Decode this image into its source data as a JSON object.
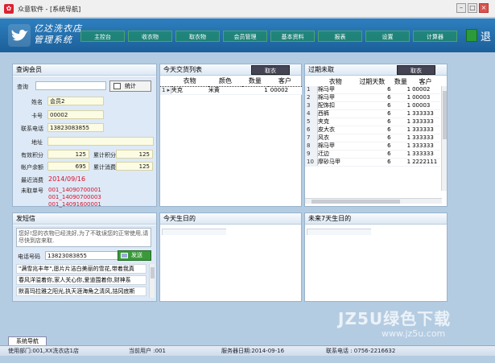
{
  "window": {
    "title": "众意软件 - [系统导航]",
    "app_icon": "app-logo-icon"
  },
  "brand": {
    "line1": "亿达洗衣店",
    "line2": "管理系统"
  },
  "nav": {
    "items": [
      "主控台",
      "收衣物",
      "取衣物",
      "会员管理",
      "基本资料",
      "报表",
      "设置",
      "计算器"
    ],
    "exit": "退"
  },
  "member": {
    "header": "查询会员",
    "query_label": "查询",
    "query_value": "",
    "stat_button": "统计",
    "name_label": "姓名",
    "name": "会员2",
    "card_label": "卡号",
    "card": "00002",
    "phone_label": "联系电话",
    "phone": "13823083855",
    "address_label": "地址",
    "address": "",
    "points_label": "有效积分",
    "points": "125",
    "total_points_label": "累计积分",
    "total_points": "125",
    "balance_label": "帐户余额",
    "balance": "695",
    "total_spent_label": "累计消费",
    "total_spent": "125",
    "last_spend_label": "最近消费",
    "last_spend": "2014/09/16",
    "unclaimed_label": "未取单号",
    "unclaimed": [
      "001_14090700001",
      "001_14090700003",
      "001_14091600001"
    ]
  },
  "today": {
    "header": "今天交货列表",
    "button": "取衣",
    "columns": [
      "衣物",
      "颜色",
      "数量",
      "客户"
    ],
    "rows": [
      {
        "idx": "1 ▸",
        "item": "夹克",
        "color": "米黄",
        "qty": "1",
        "customer": "00002"
      }
    ]
  },
  "overdue": {
    "header": "过期未取",
    "button": "取衣",
    "columns": [
      "衣物",
      "过期天数",
      "数量",
      "客户"
    ],
    "rows": [
      {
        "idx": "1",
        "item": "棉马甲",
        "days": "6",
        "qty": "1",
        "customer": "00002"
      },
      {
        "idx": "2",
        "item": "棉马甲",
        "days": "6",
        "qty": "1",
        "customer": "00003"
      },
      {
        "idx": "3",
        "item": "配饰扣",
        "days": "6",
        "qty": "1",
        "customer": "00003"
      },
      {
        "idx": "4",
        "item": "西裤",
        "days": "6",
        "qty": "1",
        "customer": "333333"
      },
      {
        "idx": "5",
        "item": "夹克",
        "days": "6",
        "qty": "1",
        "customer": "333333"
      },
      {
        "idx": "6",
        "item": "皮大衣",
        "days": "6",
        "qty": "1",
        "customer": "333333"
      },
      {
        "idx": "7",
        "item": "风衣",
        "days": "6",
        "qty": "1",
        "customer": "333333"
      },
      {
        "idx": "8",
        "item": "棉马甲",
        "days": "6",
        "qty": "1",
        "customer": "333333"
      },
      {
        "idx": "9",
        "item": "迁边",
        "days": "6",
        "qty": "1",
        "customer": "333333"
      },
      {
        "idx": "10",
        "item": "摩砂马甲",
        "days": "6",
        "qty": "1",
        "customer": "2222111"
      }
    ]
  },
  "sms": {
    "header": "发短信",
    "message": "您好!您的衣物已经洗好,为了不耽误您的正常使用,请尽快到店来取.",
    "phone_label": "电话号码",
    "phone": "13823083855",
    "send": "发送",
    "templates": [
      "\"满雪兆丰年\",愿片片洁白美丽的雪花,带着我真",
      "春风洋溢着你,家人关心你,爱道围着你,财神系",
      "默喜玛拉雅之阳光,执天涯海角之清风,拮冈底斯"
    ]
  },
  "birthday_today": {
    "header": "今天生日的"
  },
  "birthday_week": {
    "header": "未来7天生日的"
  },
  "bottom_tab": "系统导航",
  "status": {
    "dept": "使用部门:001,XX洗衣店1店",
    "user": "当前用户 :001",
    "server_date": "服务器日期:2014-09-16",
    "contact": "联系电话 : 0756-2216632"
  },
  "watermark": {
    "main": "JZ5U绿色下载",
    "sub": "www.jz5u.com"
  }
}
